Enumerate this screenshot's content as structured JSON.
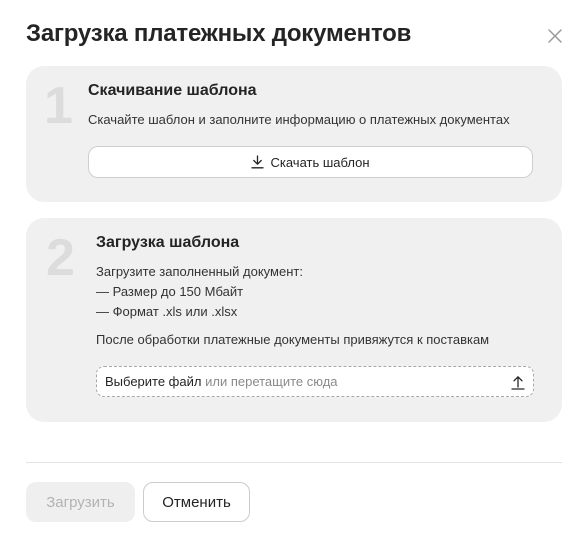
{
  "modal": {
    "title": "Загрузка платежных документов"
  },
  "step1": {
    "number": "1",
    "title": "Скачивание шаблона",
    "description": "Скачайте шаблон и заполните информацию о платежных документах",
    "download_label": "Скачать шаблон"
  },
  "step2": {
    "number": "2",
    "title": "Загрузка шаблона",
    "lines": [
      "Загрузите заполненный документ:",
      "— Размер до 150 Мбайт",
      "— Формат .xls или .xlsx",
      "После обработки платежные документы привяжутся к поставкам"
    ],
    "dropzone": {
      "primary": "Выберите файл",
      "secondary": "или перетащите сюда"
    }
  },
  "footer": {
    "submit_label": "Загрузить",
    "cancel_label": "Отменить"
  },
  "icons": {
    "close": "close-icon",
    "download": "download-icon",
    "upload": "upload-icon"
  }
}
